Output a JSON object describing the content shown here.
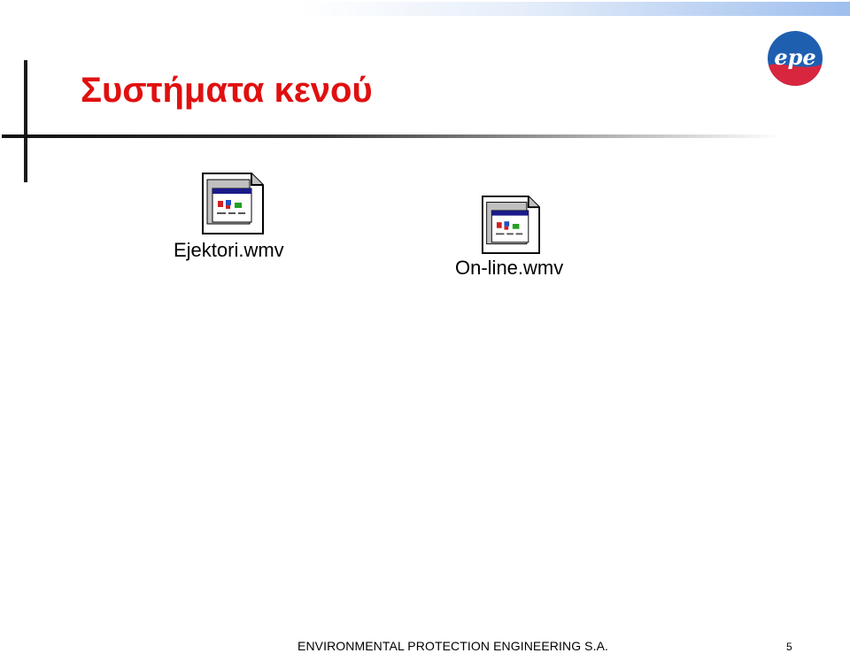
{
  "slide": {
    "title": "Συστήματα κενού",
    "logo_text": "epe",
    "files": [
      {
        "label": "Ejektori.wmv",
        "icon": "media-file-icon"
      },
      {
        "label": "On-line.wmv",
        "icon": "media-file-icon"
      }
    ],
    "footer": "ENVIRONMENTAL PROTECTION ENGINEERING S.A.",
    "page_number": "5"
  },
  "colors": {
    "title": "#e01010",
    "logo_blue": "#1f5fb0",
    "logo_red": "#d7263d",
    "accent_gradient": "#9fbfee"
  }
}
